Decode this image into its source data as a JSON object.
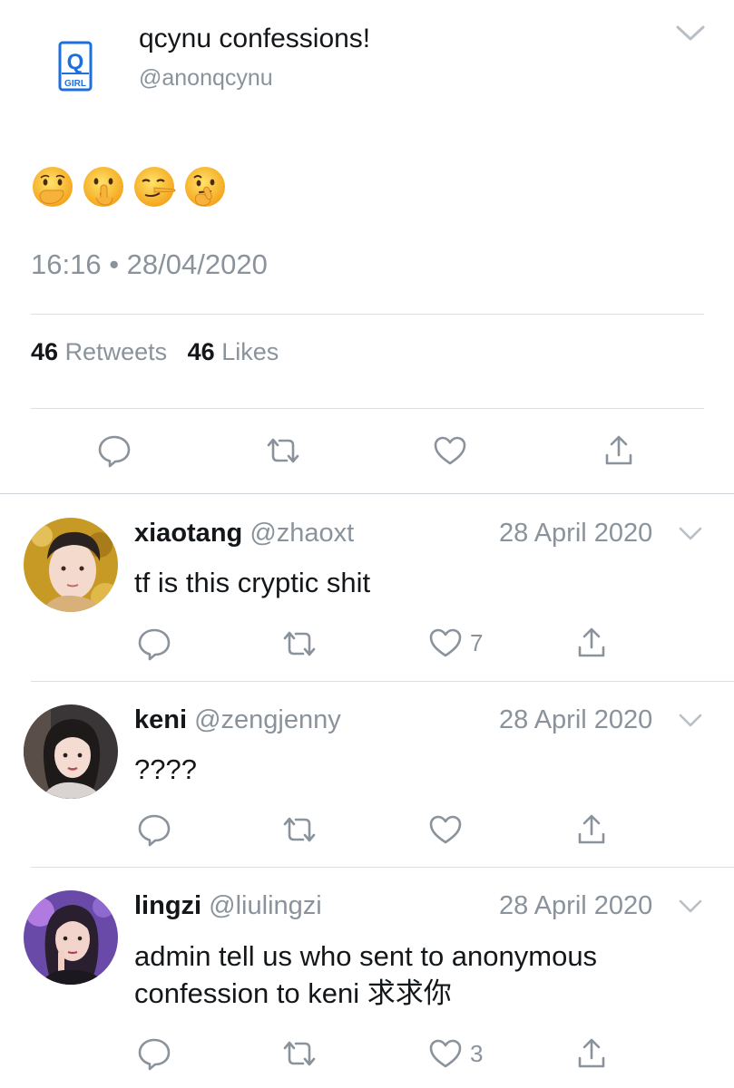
{
  "tweet": {
    "display_name": "qcynu confessions!",
    "handle": "@anonqcynu",
    "avatar_text_top": "Q",
    "avatar_text_bottom": "GIRL",
    "emojis": [
      "face-with-hand-over-mouth",
      "shushing-face",
      "lying-face",
      "thinking-face"
    ],
    "timestamp": "16:16 • 28/04/2020",
    "retweets_count": "46",
    "retweets_label": "Retweets",
    "likes_count": "46",
    "likes_label": "Likes"
  },
  "replies": [
    {
      "name": "xiaotang",
      "handle": "@zhaoxt",
      "date": "28 April 2020",
      "text": "tf is this cryptic shit",
      "likes": "7"
    },
    {
      "name": "keni",
      "handle": "@zengjenny",
      "date": "28 April 2020",
      "text": "????",
      "likes": ""
    },
    {
      "name": "lingzi",
      "handle": "@liulingzi",
      "date": "28 April 2020",
      "text": "admin tell us who sent to anonymous confession to keni 求求你",
      "likes": "3"
    }
  ],
  "colors": {
    "text": "#14171a",
    "secondary": "#8a939c",
    "divider": "#dadfe3",
    "brand_blue": "#1d6fe0"
  }
}
